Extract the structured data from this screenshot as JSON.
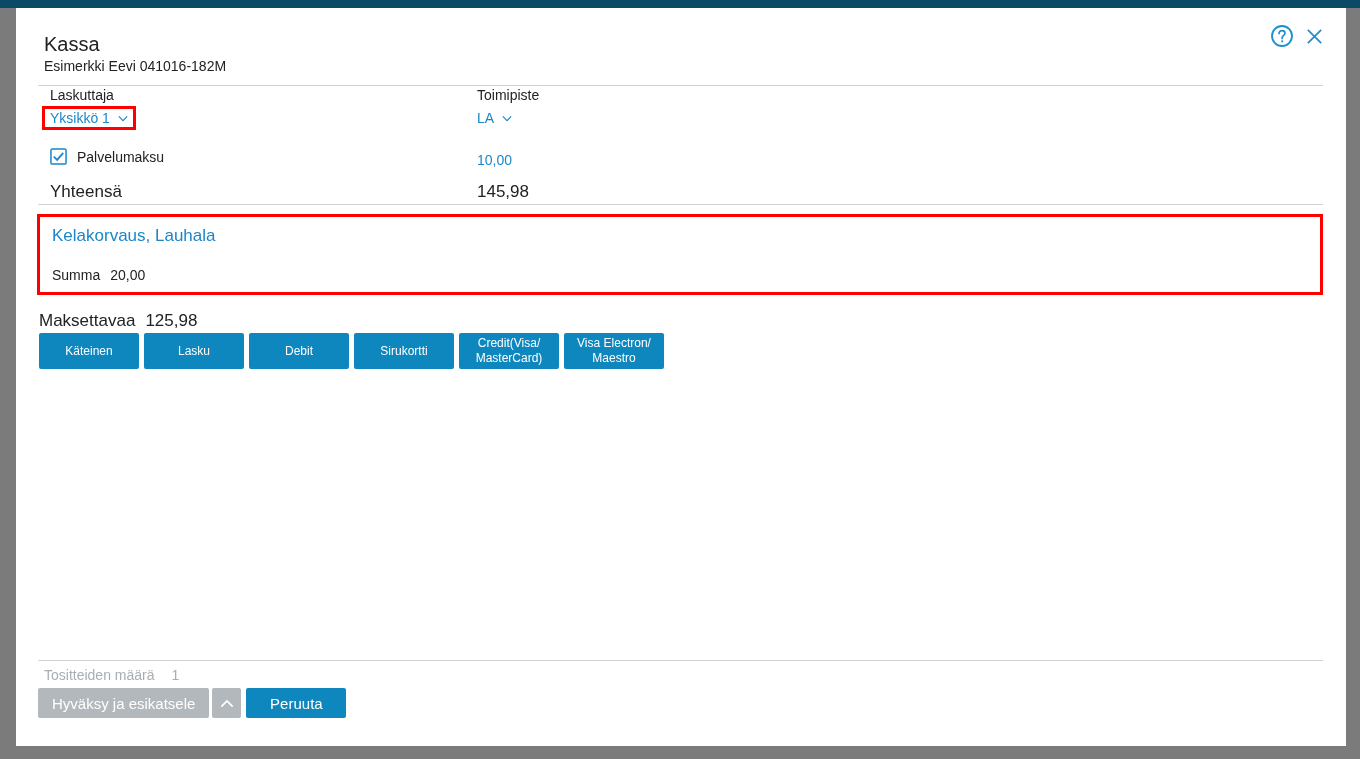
{
  "dialog": {
    "title": "Kassa",
    "subtitle": "Esimerkki Eevi 041016-182M"
  },
  "fields": [
    {
      "label": "Laskuttaja",
      "value": "Yksikkö 1",
      "highlighted": true
    },
    {
      "label": "Toimipiste",
      "value": "LA",
      "highlighted": false
    }
  ],
  "service_fee": {
    "label": "Palvelumaksu",
    "checked": true,
    "amount": "10,00"
  },
  "total": {
    "label": "Yhteensä",
    "value": "145,98"
  },
  "reimbursement": {
    "title": "Kelakorvaus, Lauhala",
    "sum_label": "Summa",
    "sum_value": "20,00",
    "highlighted": true
  },
  "amount_due": {
    "label": "Maksettavaa",
    "value": "125,98"
  },
  "payment_methods": [
    "Käteinen",
    "Lasku",
    "Debit",
    "Sirukortti",
    "Credit(Visa/\nMasterCard)",
    "Visa Electron/\nMaestro"
  ],
  "footer": {
    "count_label": "Tositteiden määrä",
    "count_value": "1",
    "buttons": [
      {
        "label": "Hyväksy ja esikatsele",
        "kind": "split",
        "disabled": true
      },
      {
        "label": "Peruuta",
        "kind": "plain",
        "disabled": false
      }
    ]
  }
}
